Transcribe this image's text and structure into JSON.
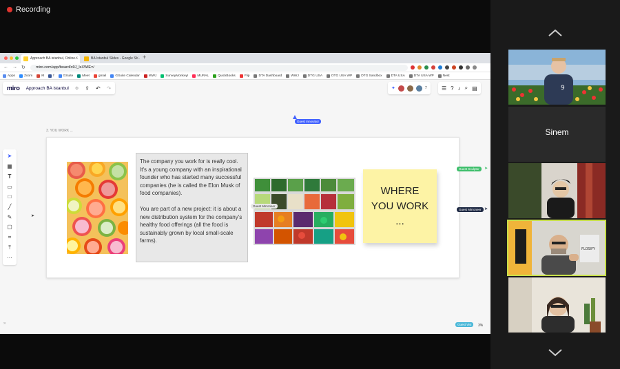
{
  "recording": {
    "label": "Recording"
  },
  "browser": {
    "tabs": [
      {
        "label": "Approach BA istanbul, Online..."
      },
      {
        "label": "BA Istanbul Slides - Google Sl..."
      }
    ],
    "url": "miro.com/app/board/o9J_lsXWlE=/",
    "bookmarks": [
      "Apps",
      "Zoom",
      "M",
      "f",
      "GSuite",
      "Meet",
      "gmail",
      "GSuite Calendar",
      "WWJ",
      "SurveyMonkey!",
      "MURAL",
      "QuickBooks",
      "Flip",
      "DTA Dashboard",
      "WWJ",
      "DTG USA",
      "DTG USA WP",
      "DTG Sandbox",
      "DTA USA",
      "DTA USA WP",
      "Nest"
    ]
  },
  "miro": {
    "logo": "miro",
    "board_name": "Approach BA istanbul",
    "collaborator_count": "7",
    "frame_label": "3. YOU WORK ...",
    "zoom": "3%",
    "content": {
      "paragraph_1": "The company you work for is really cool. It's a young company with an inspirational founder who has started many successful companies (he is called the Elon Musk of food companies).",
      "paragraph_2": "You are part of a new project: it is about a new distribution system for the company's healthy food offerings (all the food is sustainably grown by local small-scale farms).",
      "sticky_line_1": "WHERE",
      "sticky_line_2": "YOU WORK",
      "sticky_line_3": "..."
    },
    "cursors": {
      "innovator": "Guest Innovator",
      "sculptor": "Guest Sculptor",
      "mirroneer_right": "Guest Mirroneer",
      "mirroneer_board": "Guest Mirroneer",
      "visi": "Guest Visi"
    }
  },
  "participants": [
    {
      "name": ""
    },
    {
      "name": "Sinem"
    },
    {
      "name": ""
    },
    {
      "name": ""
    },
    {
      "name": ""
    }
  ],
  "colors": {
    "accent_blue": "#4262ff",
    "sticky_yellow": "#fdf3a5",
    "active_speaker": "#c8e04a",
    "sculptor_green": "#3fbf6c",
    "mirroneer_dark": "#1f2a44",
    "visi_cyan": "#4bb8d8",
    "recording_red": "#e0352f"
  }
}
